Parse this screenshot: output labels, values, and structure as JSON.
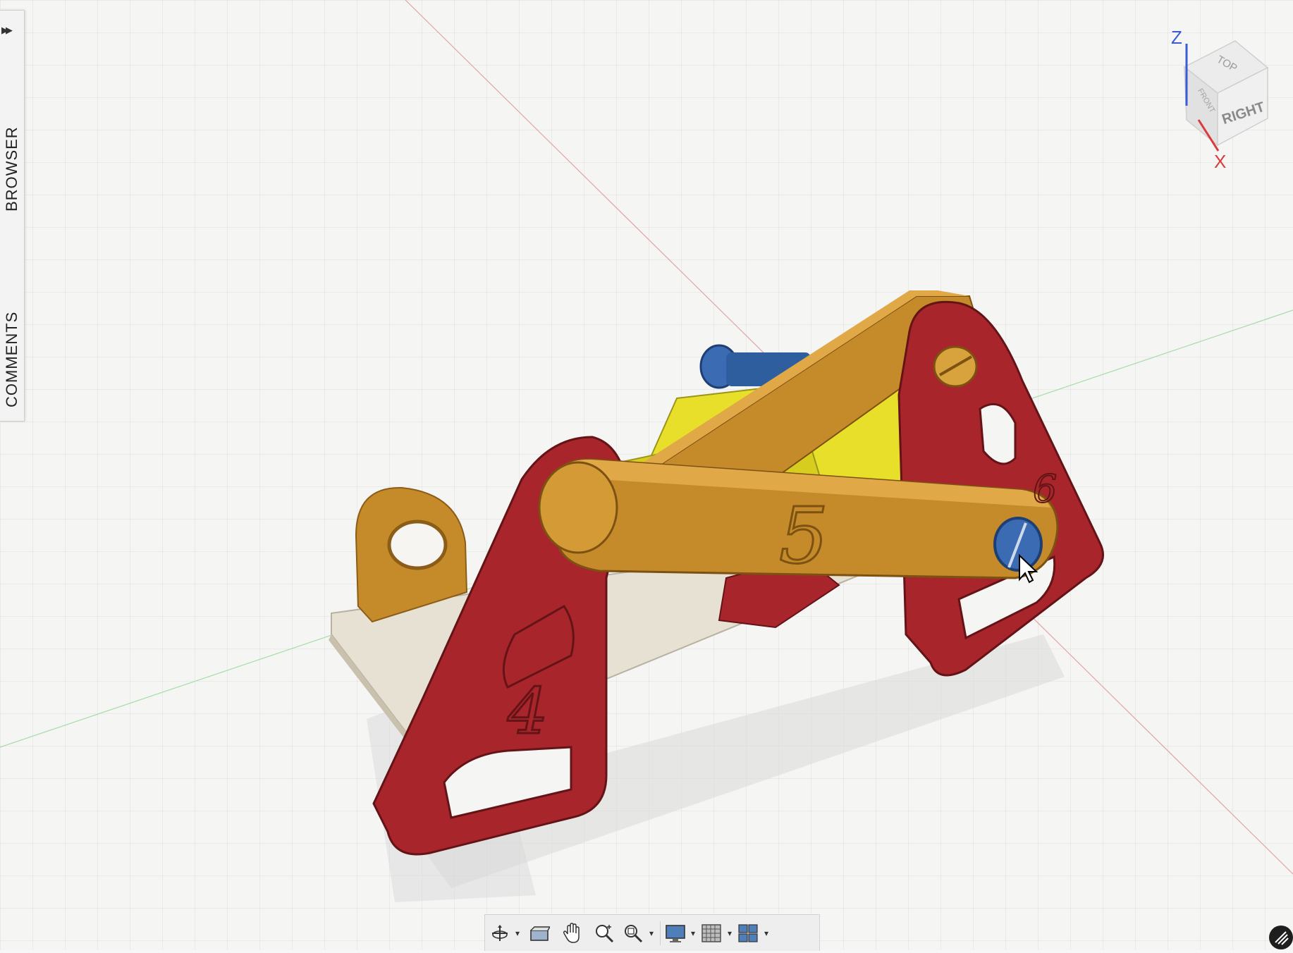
{
  "side_panel": {
    "expand_icon": "double-chevron-right-icon",
    "tabs": [
      {
        "label": "BROWSER"
      },
      {
        "label": "COMMENTS"
      }
    ]
  },
  "view_cube": {
    "axis_z": "Z",
    "axis_x": "X",
    "face_top": "TOP",
    "face_right": "RIGHT",
    "face_front": "FRONT"
  },
  "model": {
    "part_labels": [
      "5",
      "4",
      "6"
    ],
    "colors": {
      "red_frame": "#a8262b",
      "gold_link": "#c58a2a",
      "yellow_body": "#e8df2a",
      "blue_screw": "#3a6bb3",
      "base_plate": "#e7e1d4"
    }
  },
  "toolbar": {
    "items": [
      {
        "icon": "orbit-icon",
        "has_dropdown": true
      },
      {
        "icon": "look-at-icon",
        "has_dropdown": false
      },
      {
        "icon": "pan-hand-icon",
        "has_dropdown": false
      },
      {
        "icon": "zoom-icon",
        "has_dropdown": false
      },
      {
        "icon": "fit-view-icon",
        "has_dropdown": true
      },
      {
        "icon": "display-settings-icon",
        "has_dropdown": true
      },
      {
        "icon": "grid-snaps-icon",
        "has_dropdown": true
      },
      {
        "icon": "viewports-icon",
        "has_dropdown": true
      }
    ]
  },
  "caret": "▾"
}
